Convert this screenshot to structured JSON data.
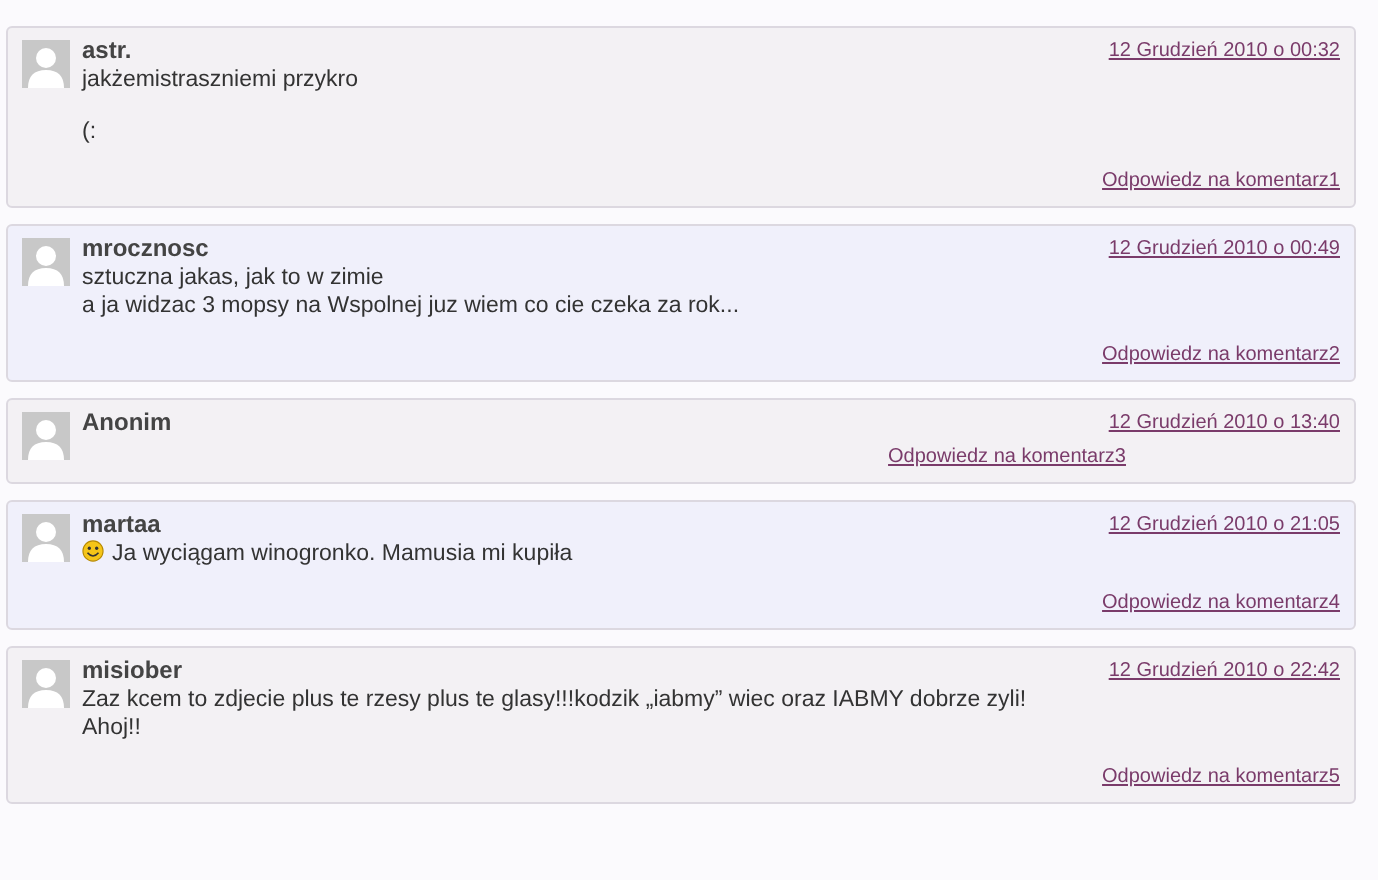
{
  "comments": [
    {
      "author": "astr.",
      "date": "12 Grudzień 2010 o 00:32",
      "smiley": false,
      "paragraphs": [
        [
          "jakżemistraszniemi przykro"
        ],
        [
          "(:"
        ]
      ],
      "reply": "Odpowiedz na komentarz1",
      "kind": "full"
    },
    {
      "author": "mrocznosc",
      "date": "12 Grudzień 2010 o 00:49",
      "smiley": false,
      "paragraphs": [
        [
          "sztuczna jakas, jak to w zimie",
          "a ja widzac 3 mopsy na Wspolnej juz wiem co cie czeka za rok..."
        ]
      ],
      "reply": "Odpowiedz na komentarz2",
      "kind": "full"
    },
    {
      "author": "Anonim",
      "date": "12 Grudzień 2010 o 13:40",
      "smiley": false,
      "reply": "Odpowiedz na komentarz3",
      "kind": "compact"
    },
    {
      "author": "martaa",
      "date": "12 Grudzień 2010 o 21:05",
      "smiley": true,
      "paragraphs": [
        [
          "Ja wyciągam winogronko. Mamusia mi kupiła"
        ]
      ],
      "reply": "Odpowiedz na komentarz4",
      "kind": "full"
    },
    {
      "author": "misiober",
      "date": "12 Grudzień 2010 o 22:42",
      "smiley": false,
      "paragraphs": [
        [
          "Zaz kcem to zdjecie plus te rzesy plus te glasy!!!kodzik „iabmy” wiec oraz IABMY dobrze zyli!",
          "Ahoj!!"
        ]
      ],
      "reply": "Odpowiedz na komentarz5",
      "kind": "full"
    }
  ]
}
